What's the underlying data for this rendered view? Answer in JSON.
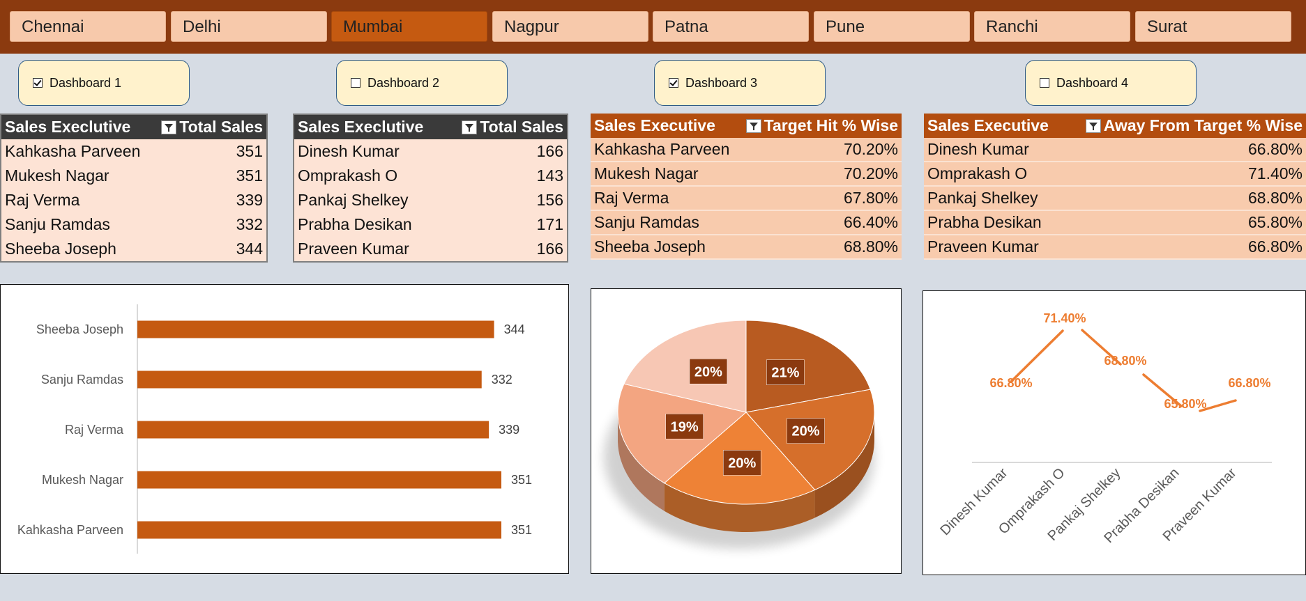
{
  "slicer": {
    "items": [
      "Chennai",
      "Delhi",
      "Mumbai",
      "Nagpur",
      "Patna",
      "Pune",
      "Ranchi",
      "Surat"
    ],
    "selected": "Mumbai"
  },
  "dashboards": [
    {
      "label": "Dashboard 1",
      "checked": true
    },
    {
      "label": "Dashboard 2",
      "checked": false
    },
    {
      "label": "Dashboard 3",
      "checked": true
    },
    {
      "label": "Dashboard 4",
      "checked": false
    }
  ],
  "tables": [
    {
      "col1": "Sales Execlutive",
      "col2": "Total Sales",
      "rows": [
        [
          "Kahkasha Parveen",
          "351"
        ],
        [
          "Mukesh Nagar",
          "351"
        ],
        [
          "Raj Verma",
          "339"
        ],
        [
          "Sanju Ramdas",
          "332"
        ],
        [
          "Sheeba Joseph",
          "344"
        ]
      ]
    },
    {
      "col1": "Sales Execlutive",
      "col2": "Total Sales",
      "rows": [
        [
          "Dinesh Kumar",
          "166"
        ],
        [
          "Omprakash O",
          "143"
        ],
        [
          "Pankaj Shelkey",
          "156"
        ],
        [
          "Prabha Desikan",
          "171"
        ],
        [
          "Praveen Kumar",
          "166"
        ]
      ]
    },
    {
      "col1": "Sales Executive",
      "col2": "Target Hit % Wise",
      "rows": [
        [
          "Kahkasha Parveen",
          "70.20%"
        ],
        [
          "Mukesh Nagar",
          "70.20%"
        ],
        [
          "Raj Verma",
          "67.80%"
        ],
        [
          "Sanju Ramdas",
          "66.40%"
        ],
        [
          "Sheeba Joseph",
          "68.80%"
        ]
      ]
    },
    {
      "col1": "Sales Executive",
      "col2": "Away From Target % Wise",
      "rows": [
        [
          "Dinesh Kumar",
          "66.80%"
        ],
        [
          "Omprakash O",
          "71.40%"
        ],
        [
          "Pankaj Shelkey",
          "68.80%"
        ],
        [
          "Prabha Desikan",
          "65.80%"
        ],
        [
          "Praveen Kumar",
          "66.80%"
        ]
      ]
    }
  ],
  "chart_data": [
    {
      "type": "bar",
      "orientation": "horizontal",
      "categories": [
        "Sheeba Joseph",
        "Sanju Ramdas",
        "Raj Verma",
        "Mukesh Nagar",
        "Kahkasha Parveen"
      ],
      "values": [
        344,
        332,
        339,
        351,
        351
      ],
      "xlim": [
        0,
        400
      ],
      "color": "#c55a11"
    },
    {
      "type": "pie",
      "slices": [
        {
          "label": "21%",
          "value": 21,
          "color": "#b85b21"
        },
        {
          "label": "20%",
          "value": 20,
          "color": "#d66f2b"
        },
        {
          "label": "20%",
          "value": 20,
          "color": "#ee8236"
        },
        {
          "label": "19%",
          "value": 19,
          "color": "#f3a581"
        },
        {
          "label": "20%",
          "value": 20,
          "color": "#f7c7b4"
        }
      ]
    },
    {
      "type": "line",
      "categories": [
        "Dinesh Kumar",
        "Omprakash O",
        "Pankaj Shelkey",
        "Prabha Desikan",
        "Praveen Kumar"
      ],
      "values": [
        66.8,
        71.4,
        68.8,
        65.8,
        66.8
      ],
      "labels": [
        "66.80%",
        "71.40%",
        "68.80%",
        "65.80%",
        "66.80%"
      ],
      "color": "#ed7d31"
    }
  ]
}
